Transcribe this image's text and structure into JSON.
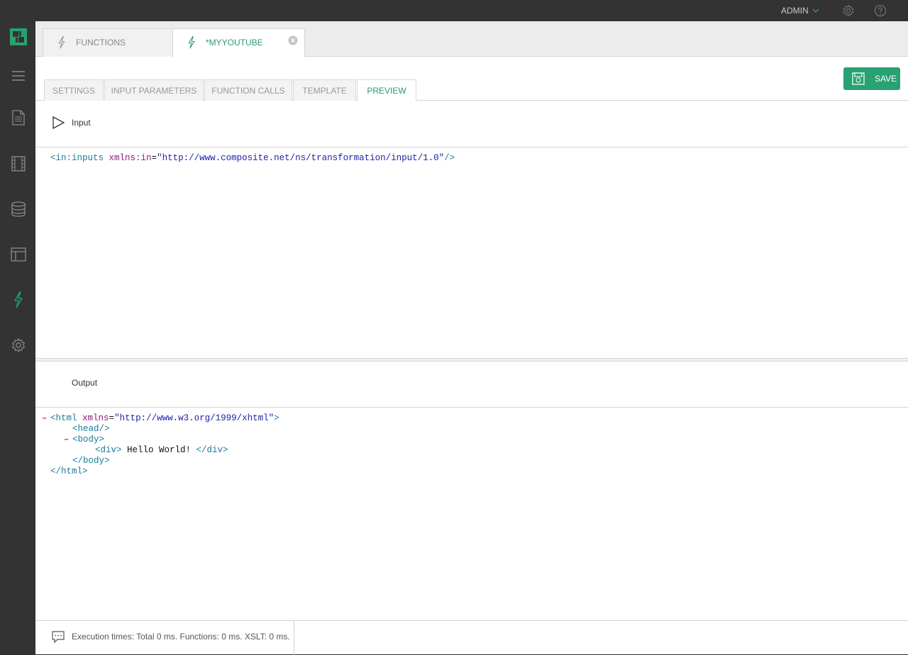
{
  "topbar": {
    "user_label": "ADMIN"
  },
  "sidebar": {
    "items": [
      {
        "icon": "menu-icon"
      },
      {
        "icon": "document-icon"
      },
      {
        "icon": "film-icon"
      },
      {
        "icon": "database-icon"
      },
      {
        "icon": "layout-icon"
      },
      {
        "icon": "function-icon"
      },
      {
        "icon": "gear-icon"
      }
    ]
  },
  "doc_tabs": [
    {
      "label": "FUNCTIONS",
      "active": false
    },
    {
      "label": "*MYYOUTUBE",
      "active": true
    }
  ],
  "sub_tabs": [
    {
      "label": "SETTINGS"
    },
    {
      "label": "INPUT PARAMETERS"
    },
    {
      "label": "FUNCTION CALLS"
    },
    {
      "label": "TEMPLATE"
    },
    {
      "label": "PREVIEW",
      "active": true
    }
  ],
  "save_label": "SAVE",
  "input": {
    "label": "Input",
    "code": {
      "open": "<",
      "tag": "in:inputs",
      "attr": "xmlns:in",
      "eq": "=",
      "value": "\"http://www.composite.net/ns/transformation/input/1.0\"",
      "close": "/>"
    }
  },
  "output": {
    "label": "Output",
    "lines": {
      "html_open_tag": "<html",
      "html_attr": "xmlns",
      "html_eq": "=",
      "html_value": "\"http://www.w3.org/1999/xhtml\"",
      "html_gt": ">",
      "head": "<head/>",
      "body_open": "<body>",
      "div_open": "<div>",
      "div_text": " Hello World! ",
      "div_close": "</div>",
      "body_close": "</body>",
      "html_close": "</html>",
      "toggle": "–"
    }
  },
  "status": {
    "text": "Execution times: Total 0 ms. Functions: 0 ms. XSLT: 0 ms."
  },
  "colors": {
    "accent": "#27a270",
    "sidebar_bg": "#333333"
  }
}
